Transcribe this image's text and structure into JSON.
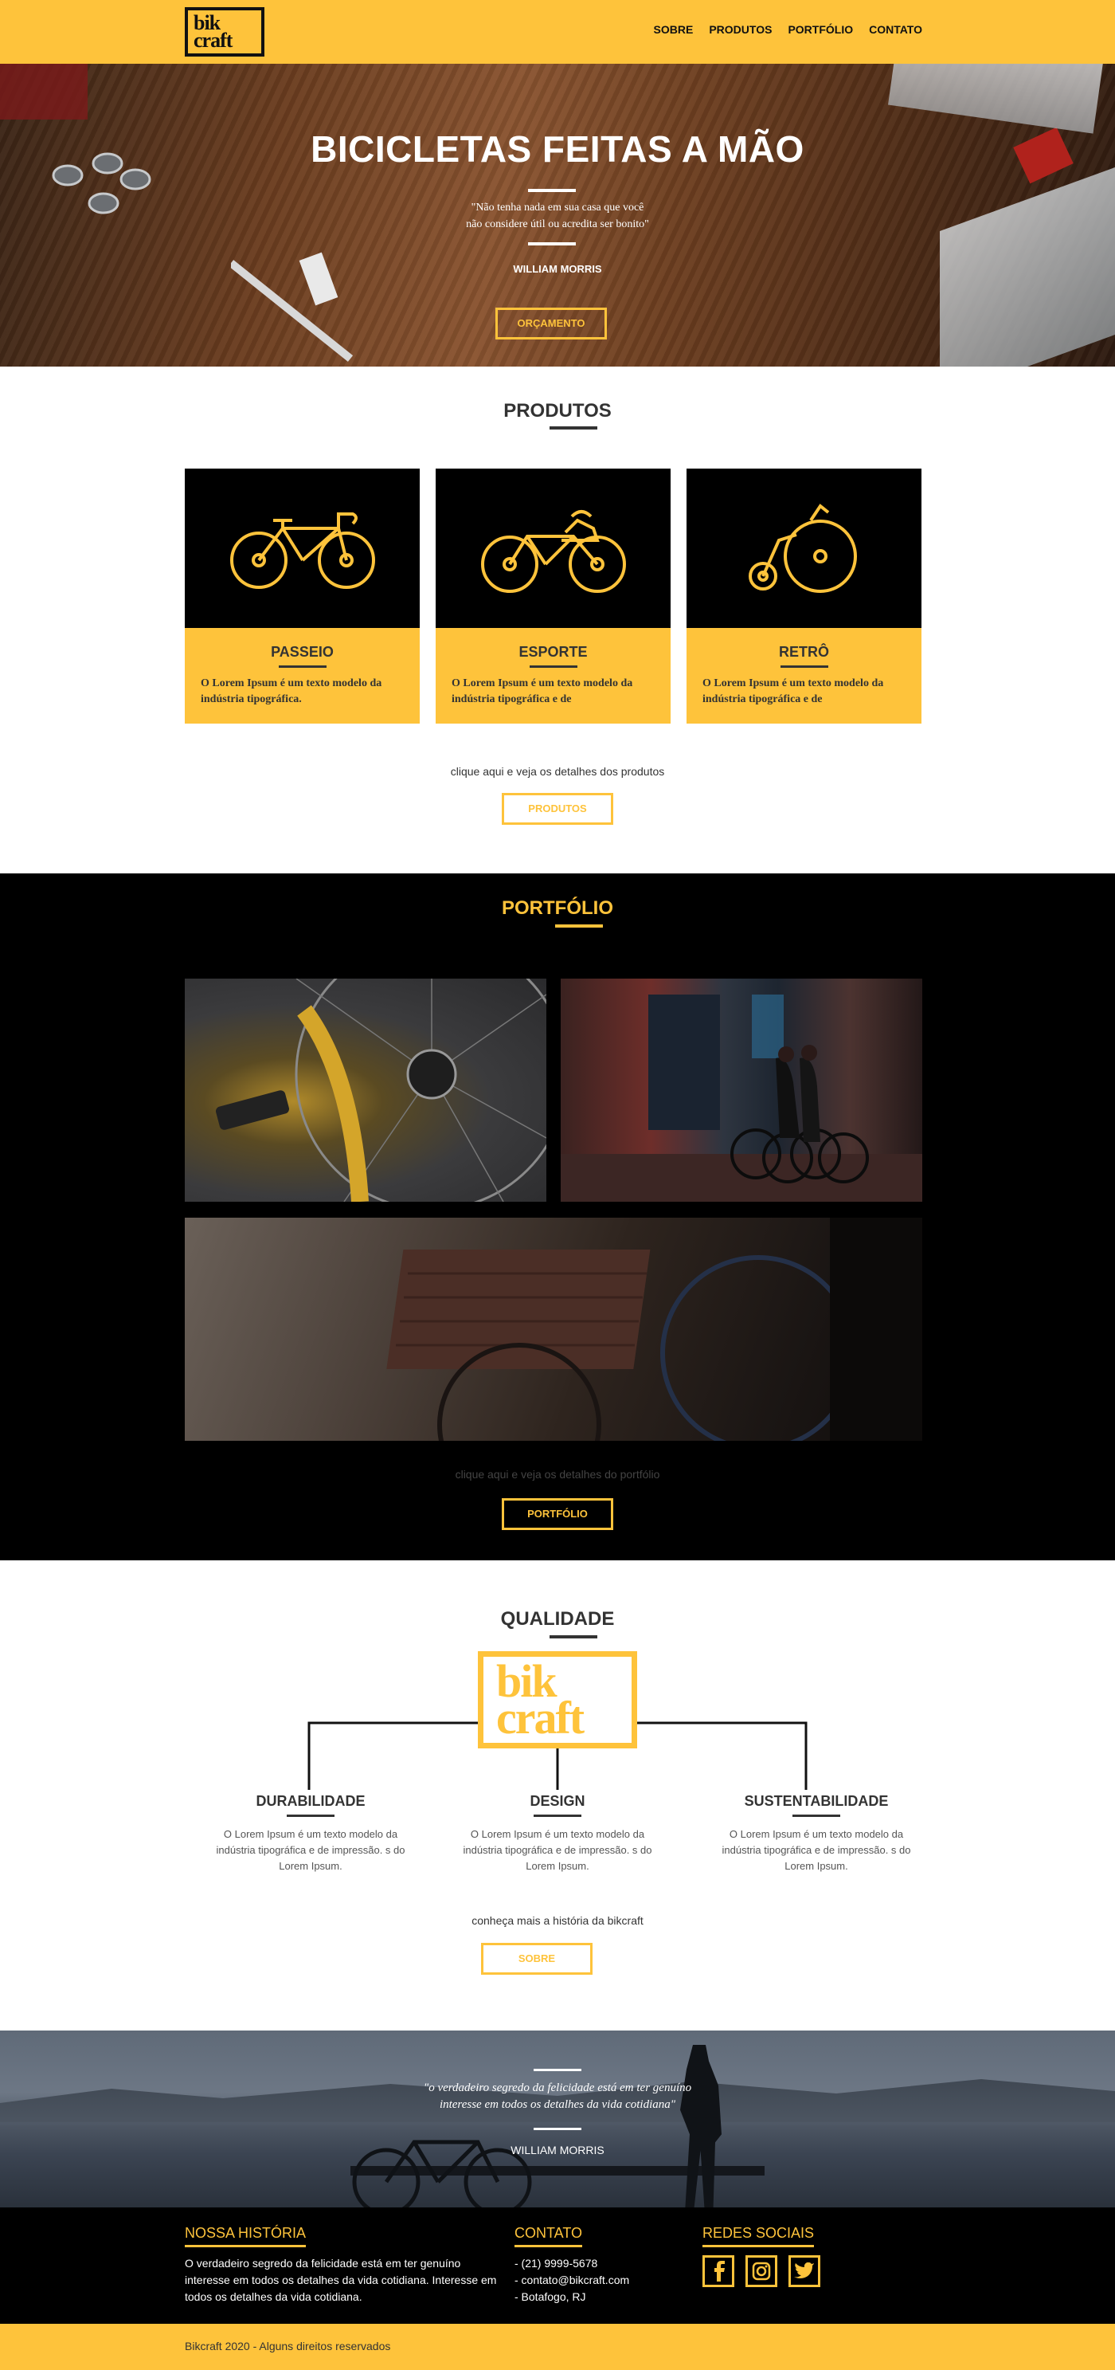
{
  "header": {
    "logo_line1": "bik",
    "logo_line2": "craft",
    "nav": [
      "SOBRE",
      "PRODUTOS",
      "PORTFÓLIO",
      "CONTATO"
    ]
  },
  "hero": {
    "title": "BICICLETAS FEITAS A MÃO",
    "quote_line1": "\"Não tenha nada em sua casa que você",
    "quote_line2": "não considere útil ou acredita ser bonito\"",
    "author": "WILLIAM MORRIS",
    "button": "ORÇAMENTO"
  },
  "produtos": {
    "title": "PRODUTOS",
    "cards": [
      {
        "name": "PASSEIO",
        "text": "O Lorem Ipsum é um texto modelo da indústria tipográfica."
      },
      {
        "name": "ESPORTE",
        "text": "O Lorem Ipsum é um texto modelo da indústria tipográfica e de"
      },
      {
        "name": "RETRÔ",
        "text": "O Lorem Ipsum é um texto modelo da indústria tipográfica e de"
      }
    ],
    "cta": "clique aqui e veja os detalhes dos produtos",
    "button": "PRODUTOS"
  },
  "portfolio": {
    "title": "PORTFÓLIO",
    "cta": "clique aqui e veja os detalhes do portfólio",
    "button": "PORTFÓLIO"
  },
  "qualidade": {
    "title": "QUALIDADE",
    "logo_line1": "bik",
    "logo_line2": "craft",
    "items": [
      {
        "name": "DURABILIDADE",
        "text": "O Lorem Ipsum é um texto modelo da indústria tipográfica e de impressão. s do Lorem Ipsum."
      },
      {
        "name": "DESIGN",
        "text": "O Lorem Ipsum é um texto modelo da indústria tipográfica e de impressão. s do Lorem Ipsum."
      },
      {
        "name": "SUSTENTABILIDADE",
        "text": "O Lorem Ipsum é um texto modelo da indústria tipográfica e de impressão. s do Lorem Ipsum."
      }
    ],
    "cta": "conheça mais a história da bikcraft",
    "button": "SOBRE"
  },
  "banner": {
    "quote_line1": "\"o verdadeiro segredo da felicidade está em ter genuíno",
    "quote_line2": "interesse em todos os detalhes da vida cotidiana\"",
    "author": "WILLIAM MORRIS"
  },
  "footer": {
    "historia_title": "NOSSA HISTÓRIA",
    "historia_line1": "O verdadeiro segredo da felicidade está em ter genuíno",
    "historia_line2": "interesse em todos os detalhes da vida cotidiana. Interesse em",
    "historia_line3": "todos os detalhes da vida cotidiana.",
    "contato_title": "CONTATO",
    "contato_phone": "- (21) 9999-5678",
    "contato_email": "- contato@bikcraft.com",
    "contato_local": "- Botafogo, RJ",
    "redes_title": "REDES SOCIAIS",
    "copyright": "Bikcraft 2020 - Alguns direitos reservados"
  },
  "colors": {
    "accent": "#fec33b",
    "dark": "#000000",
    "text": "#333333"
  },
  "icons": [
    "facebook-icon",
    "instagram-icon",
    "twitter-icon"
  ]
}
